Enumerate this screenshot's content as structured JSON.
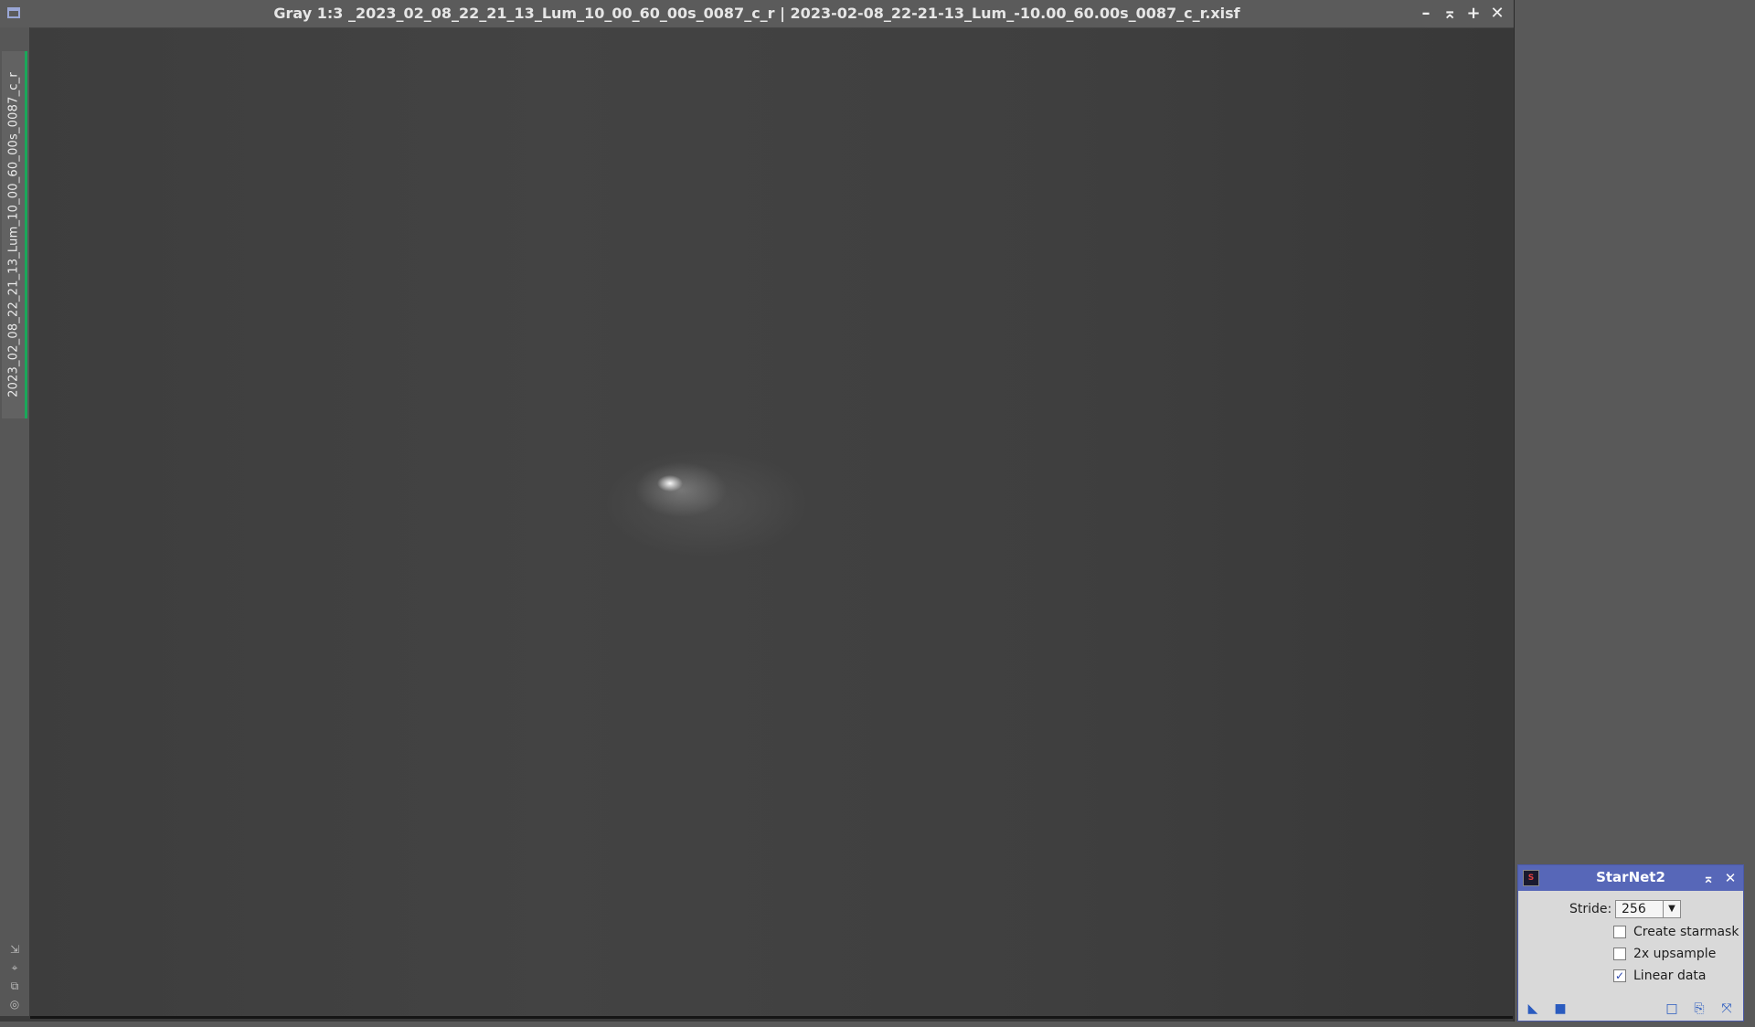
{
  "image_window": {
    "title": "Gray 1:3 _2023_02_08_22_21_13_Lum_10_00_60_00s_0087_c_r | 2023-02-08_22-21-13_Lum_-10.00_60.00s_0087_c_r.xisf",
    "tab_label": "2023_02_08_22_21_13_Lum_10_00_60_00s_0087_c_r",
    "buttons": {
      "minimize": "–",
      "shade": "⌅",
      "maximize": "+",
      "close": "✕"
    },
    "side_tools": [
      "⇲",
      "⌖",
      "⧉",
      "◎"
    ]
  },
  "tool": {
    "title": "StarNet2",
    "icon_text": "S",
    "buttons": {
      "shade": "⌅",
      "close": "✕"
    },
    "stride_label": "Stride:",
    "stride_value": "256",
    "stride_arrow": "▼",
    "checkboxes": [
      {
        "label": "Create starmask",
        "checked": false
      },
      {
        "label": "2x upsample",
        "checked": false
      },
      {
        "label": "Linear data",
        "checked": true
      }
    ],
    "footer": {
      "new_instance": "◣",
      "apply_global": "■",
      "preview": "□",
      "browse_doc": "⎘",
      "reset": "⤧"
    }
  },
  "colors": {
    "tool_title_bg": "#5767b8",
    "tab_indicator": "#1aa85a"
  }
}
